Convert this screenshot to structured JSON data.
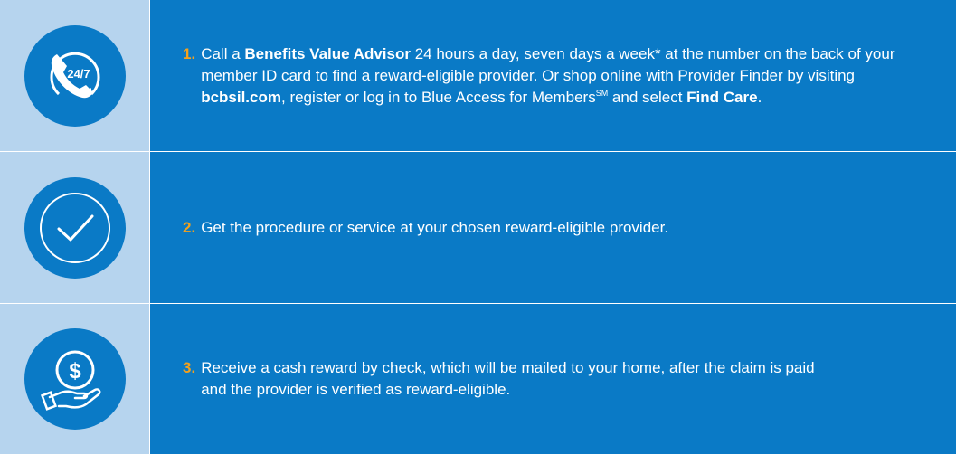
{
  "steps": [
    {
      "number": "1.",
      "icon": "phone-24-7-icon",
      "icon_text": "24/7",
      "parts": {
        "t1": "Call a ",
        "b1": "Benefits Value Advisor",
        "t2": " 24 hours a day, seven days a week* at the number on the back of your member ID card to find a reward-eligible provider. Or shop online with Provider Finder by visiting ",
        "b2": "bcbsil.com",
        "t3": ", register or log in to Blue Access for Members",
        "sup": "SM",
        "t4": " and select ",
        "b3": "Find Care",
        "t5": "."
      }
    },
    {
      "number": "2.",
      "icon": "checkmark-icon",
      "text": "Get the procedure or service at your chosen reward-eligible provider."
    },
    {
      "number": "3.",
      "icon": "hand-dollar-icon",
      "text": "Receive a cash reward by check, which will be mailed to your home, after the claim is paid and the provider is verified as reward-eligible."
    }
  ],
  "colors": {
    "primary_blue": "#0a7ac6",
    "light_blue": "#b6d4ee",
    "number_orange": "#f4a11c",
    "text": "#ffffff"
  }
}
